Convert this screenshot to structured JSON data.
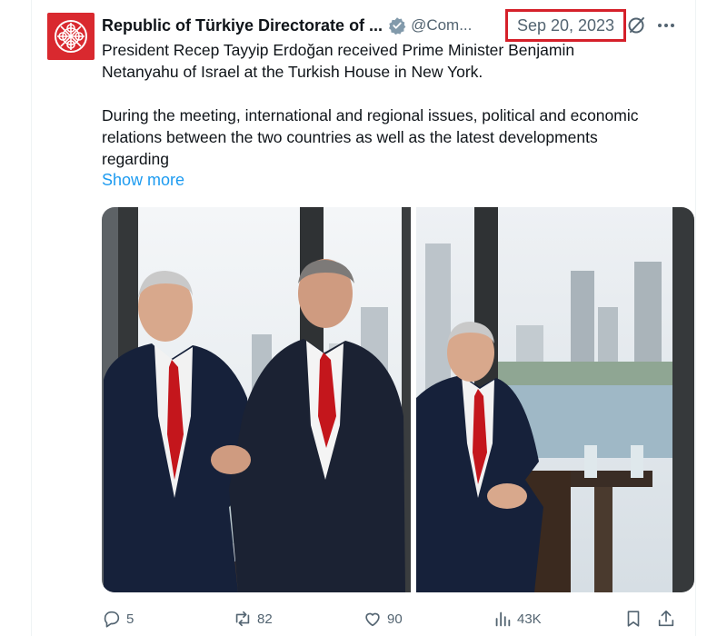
{
  "post": {
    "author": {
      "name": "Republic of Türkiye Directorate of ...",
      "handle": "@Com...",
      "verified_icon": "gray-verified-badge-icon"
    },
    "date": "Sep 20, 2023",
    "text": {
      "paragraph1": "President Recep Tayyip Erdoğan received Prime Minister Benjamin Netanyahu of Israel at the Turkish House in New York.",
      "paragraph2": "During the meeting, international and regional issues, political and economic relations between the two countries as well as the latest developments regarding"
    },
    "show_more": "Show more",
    "media": [
      "photo-handshake",
      "photo-seated"
    ],
    "actions": {
      "replies": "5",
      "reposts": "82",
      "likes": "90",
      "views": "43K"
    }
  },
  "colors": {
    "highlight_box": "#d5202a",
    "link": "#1d9bf0",
    "muted": "#536471",
    "avatar_bg": "#d9292f"
  }
}
